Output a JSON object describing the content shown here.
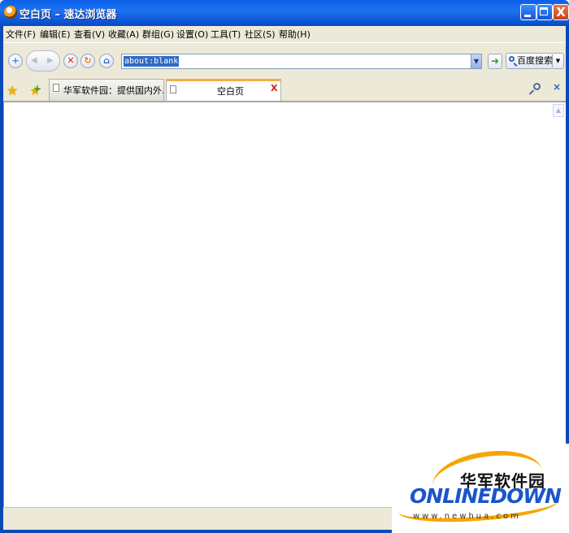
{
  "window": {
    "title": "空白页  –  速达浏览器",
    "close_glyph": "X"
  },
  "menubar": {
    "items": [
      "文件(F)",
      "编辑(E)",
      "查看(V)",
      "收藏(A)",
      "群组(G)",
      "设置(O)",
      "工具(T)",
      "社区(S)",
      "帮助(H)"
    ]
  },
  "toolbar": {
    "new_tab_glyph": "+",
    "back_glyph": "◀",
    "forward_glyph": "▶",
    "stop_glyph": "✕",
    "refresh_glyph": "↻",
    "home_glyph": "⌂",
    "address_value": "about:blank",
    "dropdown_glyph": "▼",
    "go_glyph": "➜",
    "search_label": "百度搜索",
    "search_arrow_glyph": "▼"
  },
  "tabs": [
    {
      "label": "华军软件园：提供国内外...",
      "active": false
    },
    {
      "label": "空白页",
      "active": true,
      "close_glyph": "X"
    }
  ],
  "tabbar": {
    "favorites_icon": "star-icon",
    "add_favorite_icon": "star-plus-icon",
    "close_glyph": "×"
  },
  "scrollbar": {
    "up_glyph": "▲"
  },
  "watermark": {
    "cn_text": "华军软件园",
    "logo_text": "ONLINEDOWN",
    "url_text": "www.newhua.com"
  },
  "colors": {
    "titlebar": "#0a5fe6",
    "chrome": "#ece9d8",
    "close_red": "#d0201a",
    "active_tab_accent": "#f0b040",
    "logo_blue": "#1a56c8",
    "logo_orange": "#f6a500"
  }
}
